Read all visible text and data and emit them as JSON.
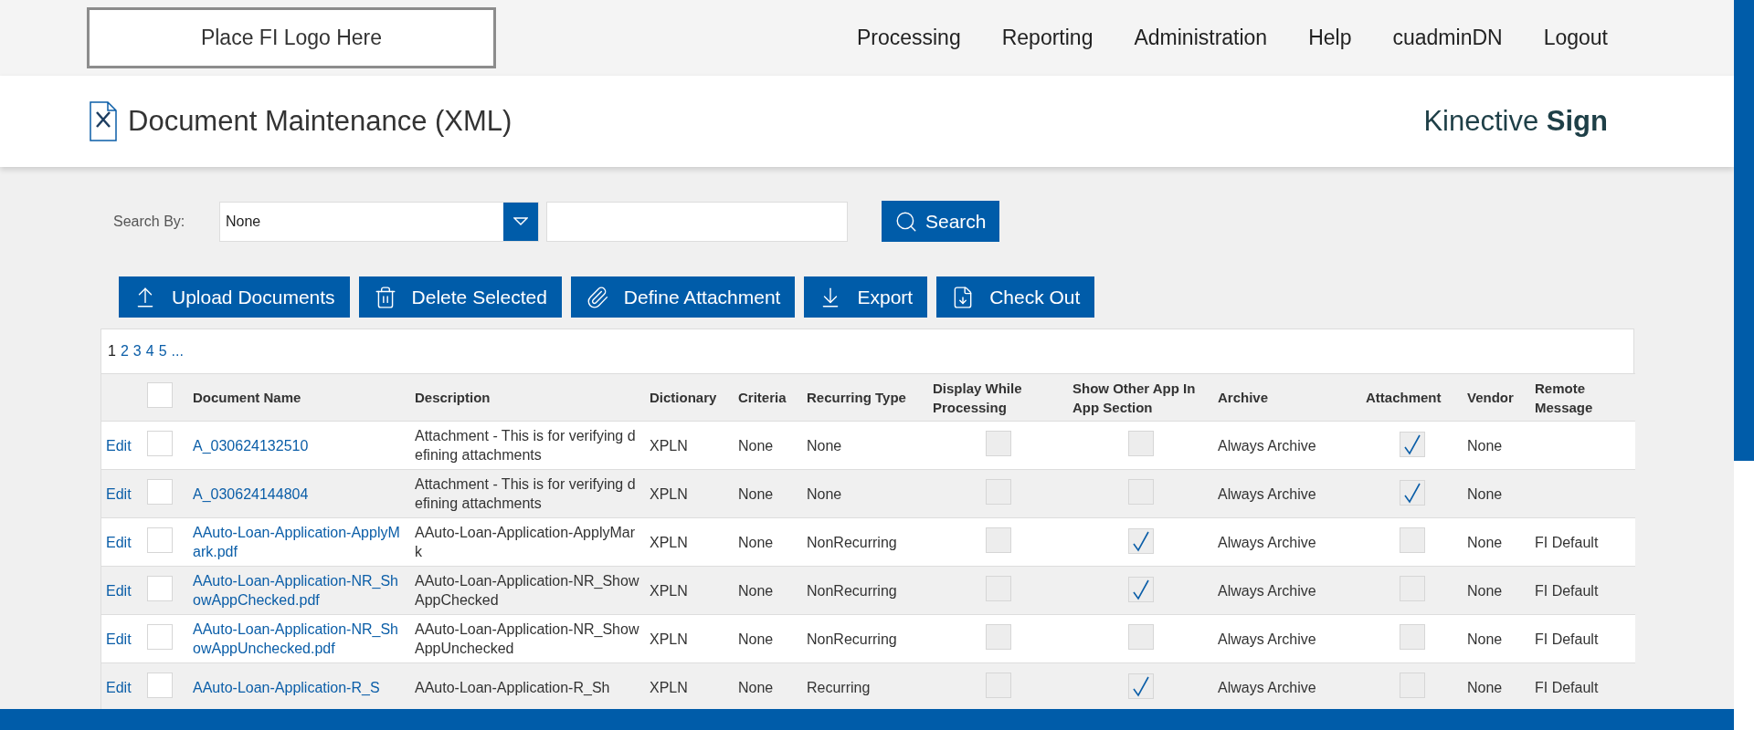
{
  "header": {
    "logo": "Place FI Logo Here",
    "nav": [
      "Processing",
      "Reporting",
      "Administration",
      "Help",
      "cuadminDN",
      "Logout"
    ]
  },
  "page_title": "Document Maintenance (XML)",
  "brand": {
    "name": "Kinective",
    "bold": "Sign"
  },
  "search": {
    "label": "Search By:",
    "select_value": "None",
    "button": "Search"
  },
  "actions": [
    {
      "label": "Upload Documents",
      "kind": "upload"
    },
    {
      "label": "Delete Selected",
      "kind": "delete"
    },
    {
      "label": "Define Attachment",
      "kind": "attach"
    },
    {
      "label": "Export",
      "kind": "export"
    },
    {
      "label": "Check Out",
      "kind": "checkout"
    }
  ],
  "pager": [
    {
      "label": "1",
      "selected": true
    },
    {
      "label": "2",
      "selected": false
    },
    {
      "label": "3",
      "selected": false
    },
    {
      "label": "4",
      "selected": false
    },
    {
      "label": "5",
      "selected": false
    },
    {
      "label": "...",
      "selected": false
    }
  ],
  "table": {
    "select_all": {
      "checked": false
    },
    "columns": [
      "Document Name",
      "Description",
      "Dictionary",
      "Criteria",
      "Recurring Type",
      "Display While Processing",
      "Show Other App In App Section",
      "Archive",
      "Attachment",
      "Vendor",
      "Remote Message"
    ],
    "rows": [
      {
        "edit": "Edit",
        "checked": false,
        "name": "A_030624132510",
        "description": "Attachment - This is for verifying defining attachments",
        "dictionary": "XPLN",
        "criteria": "None",
        "recurring_type": "None",
        "display_while_processing": false,
        "show_other_app": false,
        "archive": "Always Archive",
        "attachment": true,
        "vendor": "None"
      },
      {
        "edit": "Edit",
        "checked": false,
        "name": "A_030624144804",
        "description": "Attachment - This is for verifying defining attachments",
        "dictionary": "XPLN",
        "criteria": "None",
        "recurring_type": "None",
        "display_while_processing": false,
        "show_other_app": false,
        "archive": "Always Archive",
        "attachment": true,
        "vendor": "None"
      },
      {
        "edit": "Edit",
        "checked": false,
        "name": "AAuto-Loan-Application-ApplyMark.pdf",
        "description": "AAuto-Loan-Application-ApplyMark",
        "dictionary": "XPLN",
        "criteria": "None",
        "recurring_type": "NonRecurring",
        "display_while_processing": false,
        "show_other_app": true,
        "archive": "Always Archive",
        "attachment": false,
        "vendor": "None",
        "remote_message": "FI Default"
      },
      {
        "edit": "Edit",
        "checked": false,
        "name": "AAuto-Loan-Application-NR_ShowAppChecked.pdf",
        "description": "AAuto-Loan-Application-NR_ShowAppChecked",
        "dictionary": "XPLN",
        "criteria": "None",
        "recurring_type": "NonRecurring",
        "display_while_processing": false,
        "show_other_app": true,
        "archive": "Always Archive",
        "attachment": false,
        "vendor": "None",
        "remote_message": "FI Default"
      },
      {
        "edit": "Edit",
        "checked": false,
        "name": "AAuto-Loan-Application-NR_ShowAppUnchecked.pdf",
        "description": "AAuto-Loan-Application-NR_ShowAppUnchecked",
        "dictionary": "XPLN",
        "criteria": "None",
        "recurring_type": "NonRecurring",
        "display_while_processing": false,
        "show_other_app": false,
        "archive": "Always Archive",
        "attachment": false,
        "vendor": "None",
        "remote_message": "FI Default"
      },
      {
        "edit": "Edit",
        "checked": false,
        "name": "AAuto-Loan-Application-R_S",
        "description": "AAuto-Loan-Application-R_Sh",
        "dictionary": "XPLN",
        "criteria": "None",
        "recurring_type": "Recurring",
        "display_while_processing": false,
        "show_other_app": true,
        "archive": "Always Archive",
        "attachment": false,
        "vendor": "None",
        "remote_message": "FI Default"
      }
    ]
  }
}
